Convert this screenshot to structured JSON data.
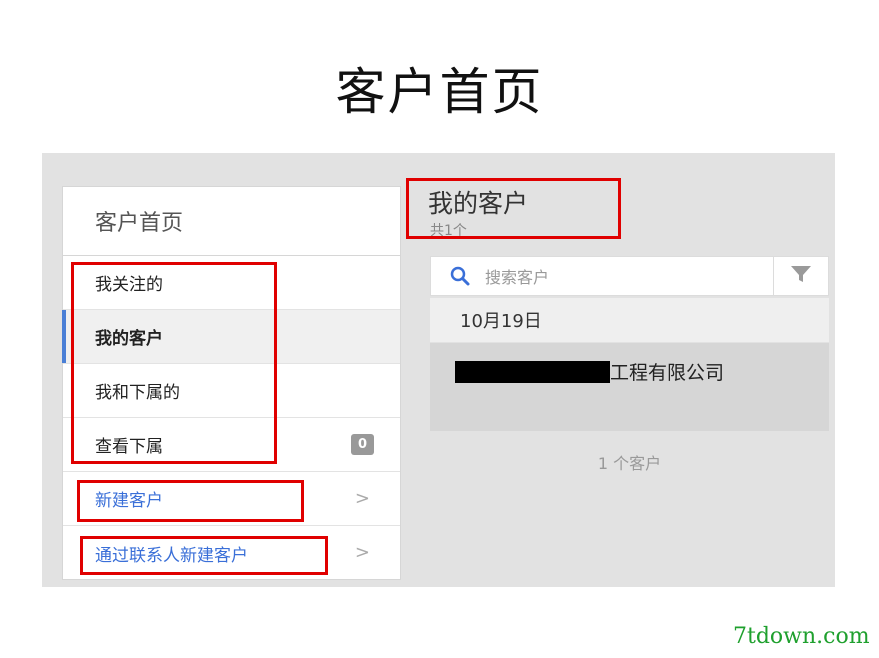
{
  "slide": {
    "title": "客户首页"
  },
  "left_panel": {
    "header": "客户首页",
    "nav_items": [
      {
        "label": "我关注的"
      },
      {
        "label": "我的客户",
        "active": true
      },
      {
        "label": "我和下属的"
      },
      {
        "label": "查看下属",
        "badge": "0"
      }
    ],
    "links": [
      {
        "label": "新建客户",
        "chevron": ">"
      },
      {
        "label": "通过联系人新建客户",
        "chevron": ">"
      }
    ]
  },
  "main": {
    "title": "我的客户",
    "subtitle": "共1个",
    "search": {
      "placeholder": "搜索客户",
      "icon": "search-icon"
    },
    "filter": {
      "icon": "filter-icon"
    },
    "date_group": "10月19日",
    "customers": [
      {
        "name": "工程有限公司",
        "redacted_prefix": true
      }
    ],
    "total": "1 个客户"
  },
  "colors": {
    "accent_blue": "#3a6fd8",
    "annotation_red": "#e00000",
    "watermark_green": "#1fa02e"
  },
  "watermark": "7tdown.com"
}
